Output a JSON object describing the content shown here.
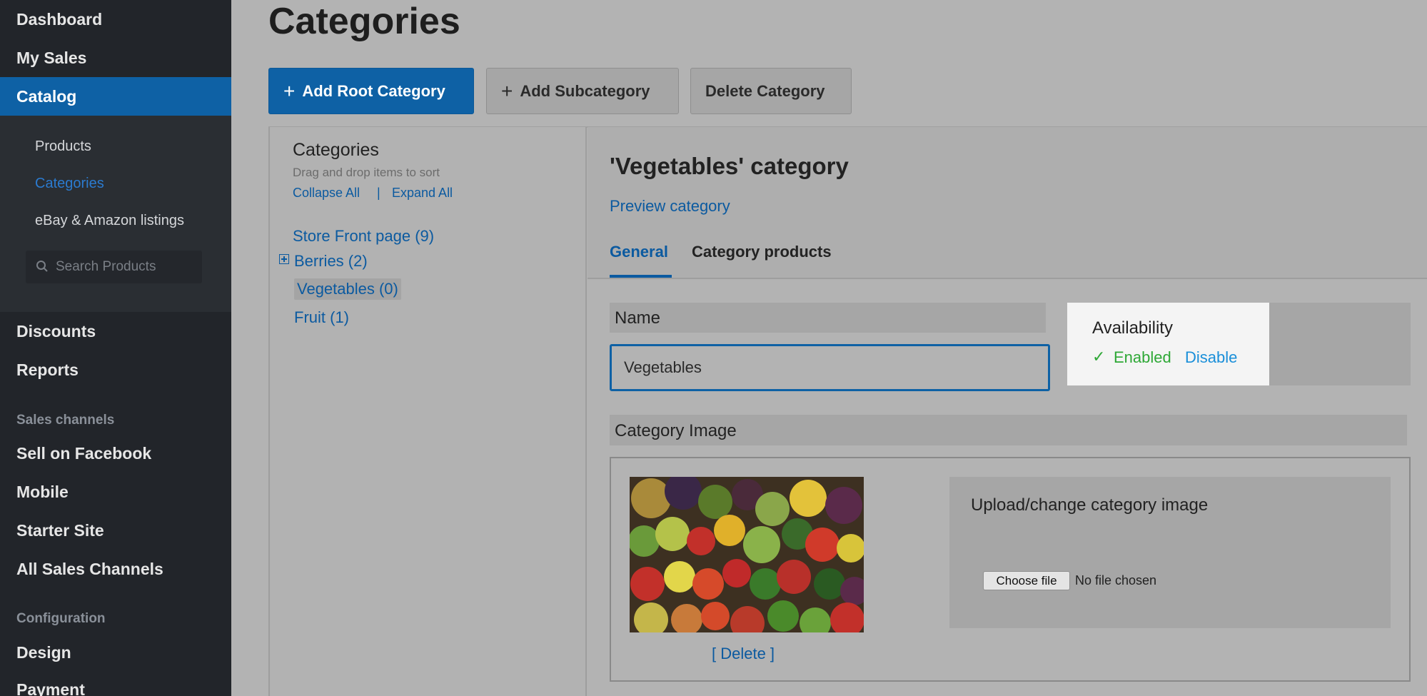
{
  "sidebar": {
    "top_items": [
      "Dashboard",
      "My Sales"
    ],
    "active_item": "Catalog",
    "sub_items": [
      "Products",
      "Categories",
      "eBay & Amazon listings"
    ],
    "active_sub_index": 1,
    "search_placeholder": "Search Products",
    "items_after": [
      "Discounts",
      "Reports"
    ],
    "section_sales_channels": "Sales channels",
    "channels": [
      "Sell on Facebook",
      "Mobile",
      "Starter Site",
      "All Sales Channels"
    ],
    "section_configuration": "Configuration",
    "config_items": [
      "Design",
      "Payment"
    ]
  },
  "page": {
    "title": "Categories"
  },
  "toolbar": {
    "add_root": "Add Root Category",
    "add_sub": "Add Subcategory",
    "delete": "Delete Category",
    "plus": "+"
  },
  "tree": {
    "title": "Categories",
    "hint": "Drag and drop items to sort",
    "collapse_all": "Collapse All",
    "separator": "|",
    "expand_all": "Expand All",
    "nodes": [
      "Store Front page (9)",
      "Berries (2)",
      "Vegetables (0)",
      "Fruit (1)"
    ]
  },
  "detail": {
    "title": "'Vegetables' category",
    "preview_link": "Preview category",
    "tabs": [
      "General",
      "Category products"
    ],
    "name_label": "Name",
    "name_value": "Vegetables",
    "availability_label": "Availability",
    "enabled_check": "✓",
    "enabled_label": "Enabled",
    "disable_link": "Disable",
    "image_label": "Category Image",
    "delete_link": "[ Delete ]",
    "upload_title": "Upload/change category image",
    "choose_file": "Choose file",
    "no_file": "No file chosen"
  },
  "colors": {
    "accent": "#0e61a5",
    "sidebar_bg": "#22252a",
    "enabled_green": "#2ea836",
    "link_blue": "#0b5aa0"
  }
}
